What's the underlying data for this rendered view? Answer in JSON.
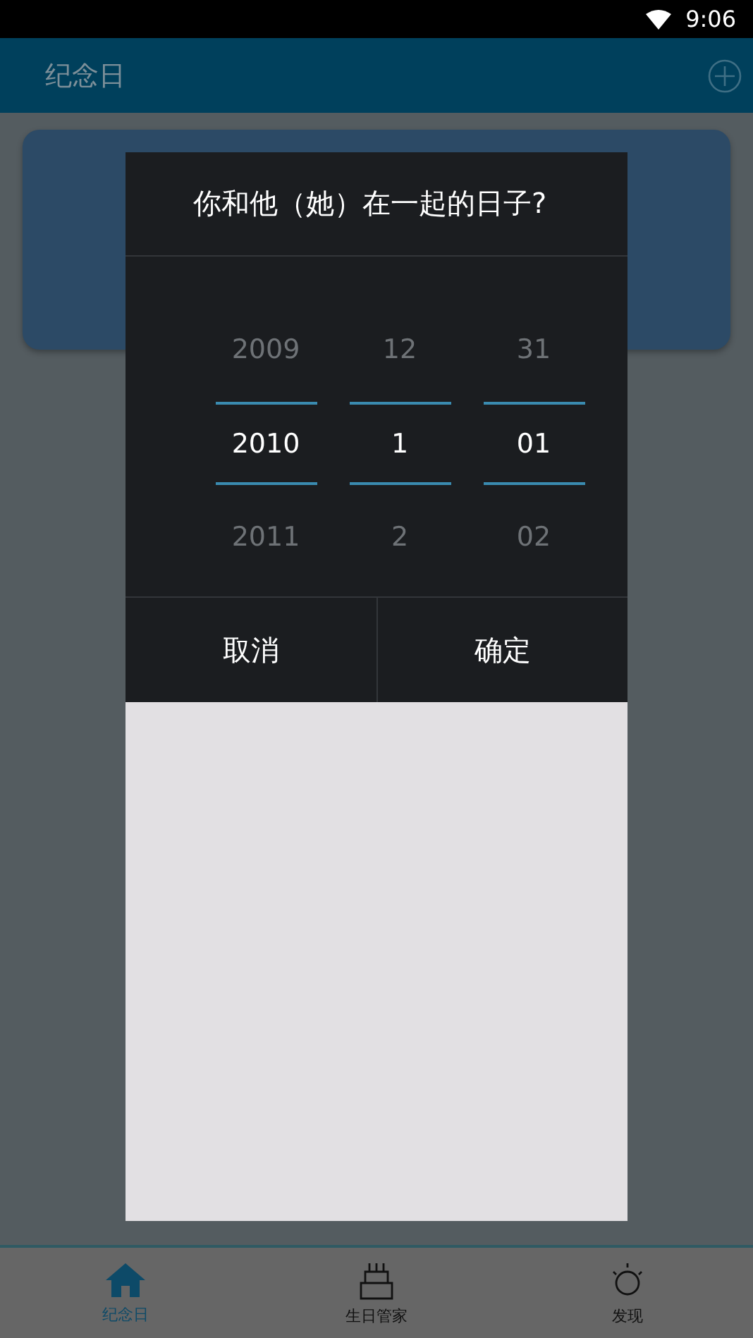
{
  "status_bar": {
    "time": "9:06"
  },
  "app_bar": {
    "title": "纪念日"
  },
  "dialog": {
    "title": "你和他（她）在一起的日子?",
    "columns": [
      {
        "above": "2009",
        "value": "2010",
        "below": "2011"
      },
      {
        "above": "12",
        "value": "1",
        "below": "2"
      },
      {
        "above": "31",
        "value": "01",
        "below": "02"
      }
    ],
    "buttons": [
      "取消",
      "确定"
    ]
  },
  "bottom_nav": [
    {
      "label": "纪念日",
      "selected": true
    },
    {
      "label": "生日管家",
      "selected": false
    },
    {
      "label": "发现",
      "selected": false
    }
  ]
}
